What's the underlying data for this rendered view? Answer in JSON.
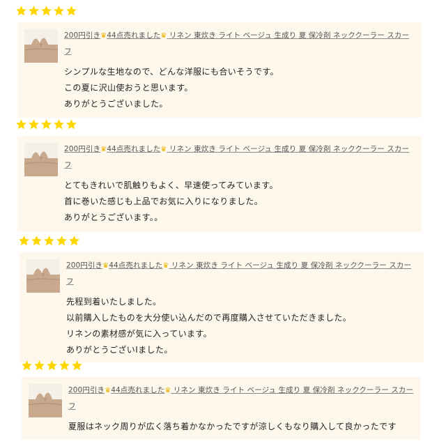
{
  "product": {
    "title_parts": [
      "200円引き",
      "44点売れました",
      " リネン 東炊き ライト ベージュ 生成り 夏 保冷剤 ネッククーラー スカー",
      "フ"
    ],
    "crown_icon": "crown-icon"
  },
  "colors": {
    "star": "#ffd700",
    "card_bg": "#fdf7ec",
    "thumb_bg": "#c8a98e"
  },
  "reviews": [
    {
      "rating": 5,
      "lines": [
        "シンプルな生地なので、どんな洋服にも合いそうです。",
        "この夏に沢山使おうと思います。",
        "ありがとうございました。"
      ]
    },
    {
      "rating": 5,
      "lines": [
        "とてもきれいで肌触りもよく、早速使ってみています。",
        "首に巻いた感じも上品でお気に入りになりました。",
        "ありがとうございます。。"
      ]
    },
    {
      "rating": 5,
      "lines": [
        "先程到着いたしました。",
        "以前購入したものを大分使い込んだので再度購入させていただきました。",
        "リネンの素材感が気に入っています。",
        "ありがとうございIました。"
      ]
    },
    {
      "rating": 5,
      "lines": [
        "夏服はネック周りが広く落ち着かなかったですが涼しくもなり購入して良かったです"
      ]
    }
  ]
}
